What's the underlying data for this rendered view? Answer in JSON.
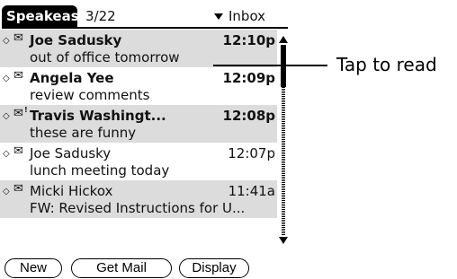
{
  "header": {
    "app_title": "Speakeas",
    "message_count": "3/22",
    "folder": "Inbox"
  },
  "messages": [
    {
      "sender": "Joe Sadusky",
      "time": "12:10p",
      "subject": "out of office tomorrow",
      "unread": true,
      "shaded": true
    },
    {
      "sender": "Angela Yee",
      "time": "12:09p",
      "subject": "review comments",
      "unread": true,
      "shaded": false
    },
    {
      "sender": "Travis Washingt...",
      "time": "12:08p",
      "subject": "these are funny",
      "unread": true,
      "shaded": true,
      "priority_flag": "!"
    },
    {
      "sender": "Joe Sadusky",
      "time": "12:07p",
      "subject": "lunch meeting today",
      "unread": false,
      "shaded": false
    },
    {
      "sender": "Micki Hickox",
      "time": "11:41a",
      "subject": "FW: Revised Instructions for U...",
      "unread": false,
      "shaded": true
    }
  ],
  "buttons": {
    "new": "New",
    "get_mail": "Get Mail",
    "display": "Display"
  },
  "callout": {
    "text": "Tap to read"
  },
  "icons": {
    "status": "diamond-icon",
    "message": "envelope-icon"
  }
}
